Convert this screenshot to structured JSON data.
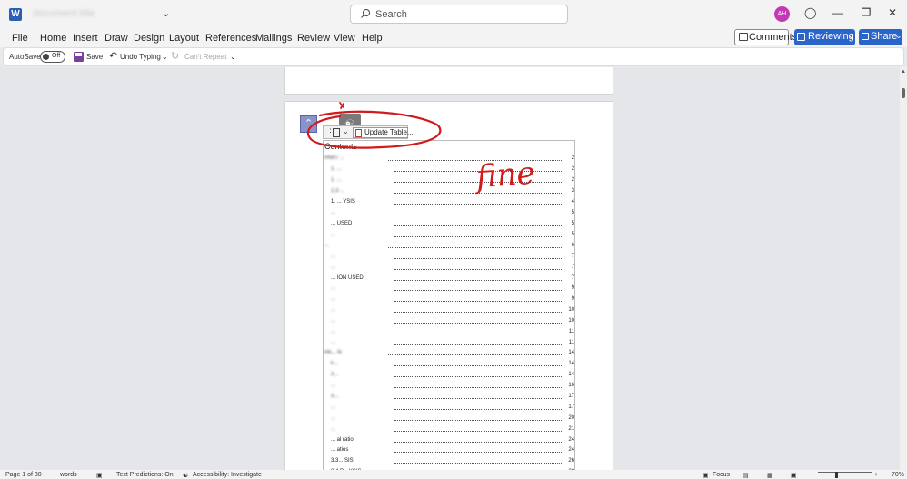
{
  "titlebar": {
    "logo": "W",
    "doc_title": "document title",
    "chevron": "⌄",
    "search_placeholder": "Search",
    "avatar_initials": "AH",
    "icons": [
      "word-logo-icon",
      "search-icon",
      "lightbulb-icon",
      "minimize-icon",
      "restore-icon",
      "close-icon"
    ]
  },
  "menu": {
    "tabs": [
      "File",
      "Home",
      "Insert",
      "Draw",
      "Design",
      "Layout",
      "References",
      "Mailings",
      "Review",
      "View",
      "Help"
    ],
    "comments_label": "Comments",
    "reviewing_label": "Reviewing",
    "share_label": "Share"
  },
  "qat": {
    "autosave_label": "AutoSave",
    "autosave_state": "Off",
    "save_label": "Save",
    "undo_label": "Undo Typing",
    "redo_label": "Can't Repeat"
  },
  "doc": {
    "update_table_label": "Update Table...",
    "toc_heading": "Contents",
    "annotation_text": "fine",
    "toc": [
      {
        "text": "PART ...",
        "page": "2",
        "blur": true
      },
      {
        "text": "1. ...",
        "page": "2",
        "blur": true
      },
      {
        "text": "1. ...",
        "page": "2",
        "blur": true
      },
      {
        "text": "1.3 ...",
        "page": "3",
        "blur": true
      },
      {
        "text": "1. ... YSIS",
        "page": "4",
        "blur": false
      },
      {
        "text": "...",
        "page": "5",
        "blur": true
      },
      {
        "text": "... USED",
        "page": "5",
        "blur": false
      },
      {
        "text": "...",
        "page": "5",
        "blur": true
      },
      {
        "text": "...",
        "page": "6",
        "blur": true
      },
      {
        "text": "...",
        "page": "7",
        "blur": true
      },
      {
        "text": "...",
        "page": "7",
        "blur": true
      },
      {
        "text": "... ION USED",
        "page": "7",
        "blur": false
      },
      {
        "text": "...",
        "page": "9",
        "blur": true
      },
      {
        "text": "...",
        "page": "9",
        "blur": true
      },
      {
        "text": "...",
        "page": "10",
        "blur": true
      },
      {
        "text": "...",
        "page": "10",
        "blur": true
      },
      {
        "text": "...",
        "page": "11",
        "blur": true
      },
      {
        "text": "...",
        "page": "11",
        "blur": true
      },
      {
        "text": "PA... N",
        "page": "14",
        "blur": true
      },
      {
        "text": "F...",
        "page": "14",
        "blur": true
      },
      {
        "text": "3...",
        "page": "14",
        "blur": true
      },
      {
        "text": "...",
        "page": "16",
        "blur": true
      },
      {
        "text": "3...",
        "page": "17",
        "blur": true
      },
      {
        "text": "...",
        "page": "17",
        "blur": true
      },
      {
        "text": "...",
        "page": "20",
        "blur": true
      },
      {
        "text": "...",
        "page": "21",
        "blur": true
      },
      {
        "text": "... al ratio",
        "page": "24",
        "blur": false
      },
      {
        "text": "... atios",
        "page": "24",
        "blur": false
      },
      {
        "text": "3.3... SIS",
        "page": "26",
        "blur": false
      },
      {
        "text": "3.4 P... YSIS",
        "page": "28",
        "blur": false
      }
    ]
  },
  "status": {
    "page": "Page 1 of 30",
    "words": "words",
    "text_predictions": "Text Predictions: On",
    "accessibility": "Accessibility: Investigate",
    "focus": "Focus",
    "zoom": "70%"
  },
  "colors": {
    "annotation_red": "#d11a1a",
    "accent_blue": "#2b65c9",
    "avatar": "#c239b3"
  }
}
